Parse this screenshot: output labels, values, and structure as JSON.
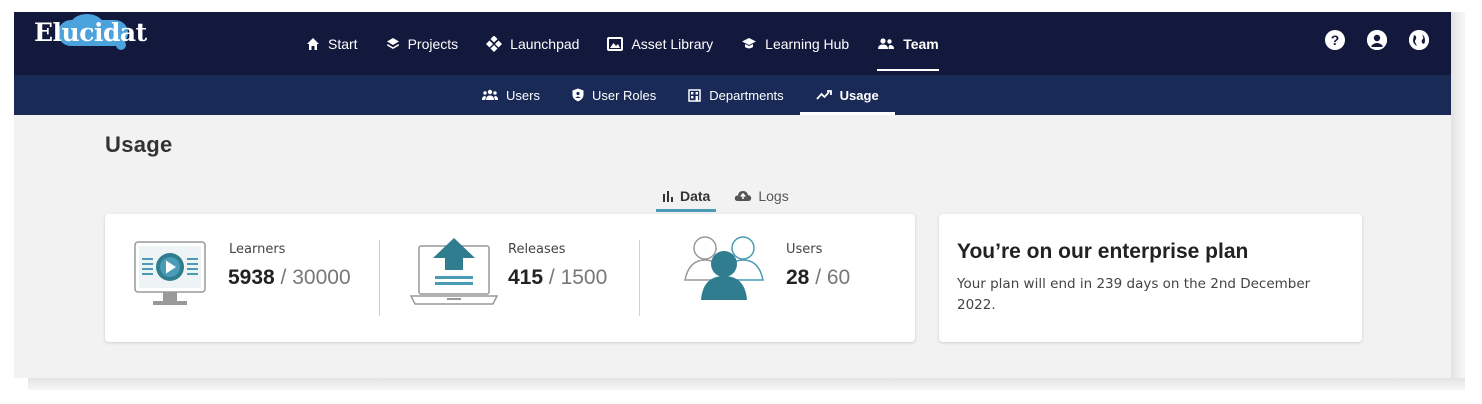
{
  "brand": {
    "name": "Elucidat",
    "color": "#4ba3de"
  },
  "colors": {
    "topbar": "#13183d",
    "subbar": "#1a2a57",
    "accent": "#4a9bb5"
  },
  "main_nav": [
    {
      "label": "Start",
      "icon": "home-icon"
    },
    {
      "label": "Projects",
      "icon": "layers-icon"
    },
    {
      "label": "Launchpad",
      "icon": "launchpad-icon"
    },
    {
      "label": "Asset Library",
      "icon": "image-icon"
    },
    {
      "label": "Learning Hub",
      "icon": "graduation-cap-icon"
    },
    {
      "label": "Team",
      "icon": "team-icon",
      "active": true
    }
  ],
  "top_icons": {
    "help": "?",
    "user": "user-icon",
    "language": "globe-icon"
  },
  "sub_nav": [
    {
      "label": "Users",
      "icon": "users-icon"
    },
    {
      "label": "User Roles",
      "icon": "shield-icon"
    },
    {
      "label": "Departments",
      "icon": "building-icon"
    },
    {
      "label": "Usage",
      "icon": "chart-line-icon",
      "active": true
    }
  ],
  "page": {
    "title": "Usage"
  },
  "tabs": [
    {
      "label": "Data",
      "icon": "bar-chart-icon",
      "active": true
    },
    {
      "label": "Logs",
      "icon": "cloud-icon"
    }
  ],
  "stats": {
    "learners": {
      "label": "Learners",
      "used": "5938",
      "sep": " / ",
      "limit": "30000"
    },
    "releases": {
      "label": "Releases",
      "used": "415",
      "sep": " / ",
      "limit": "1500"
    },
    "users": {
      "label": "Users",
      "used": "28",
      "sep": " / ",
      "limit": "60"
    }
  },
  "plan": {
    "title": "You’re on our enterprise plan",
    "description": "Your plan will end in 239 days on the 2nd December 2022."
  }
}
